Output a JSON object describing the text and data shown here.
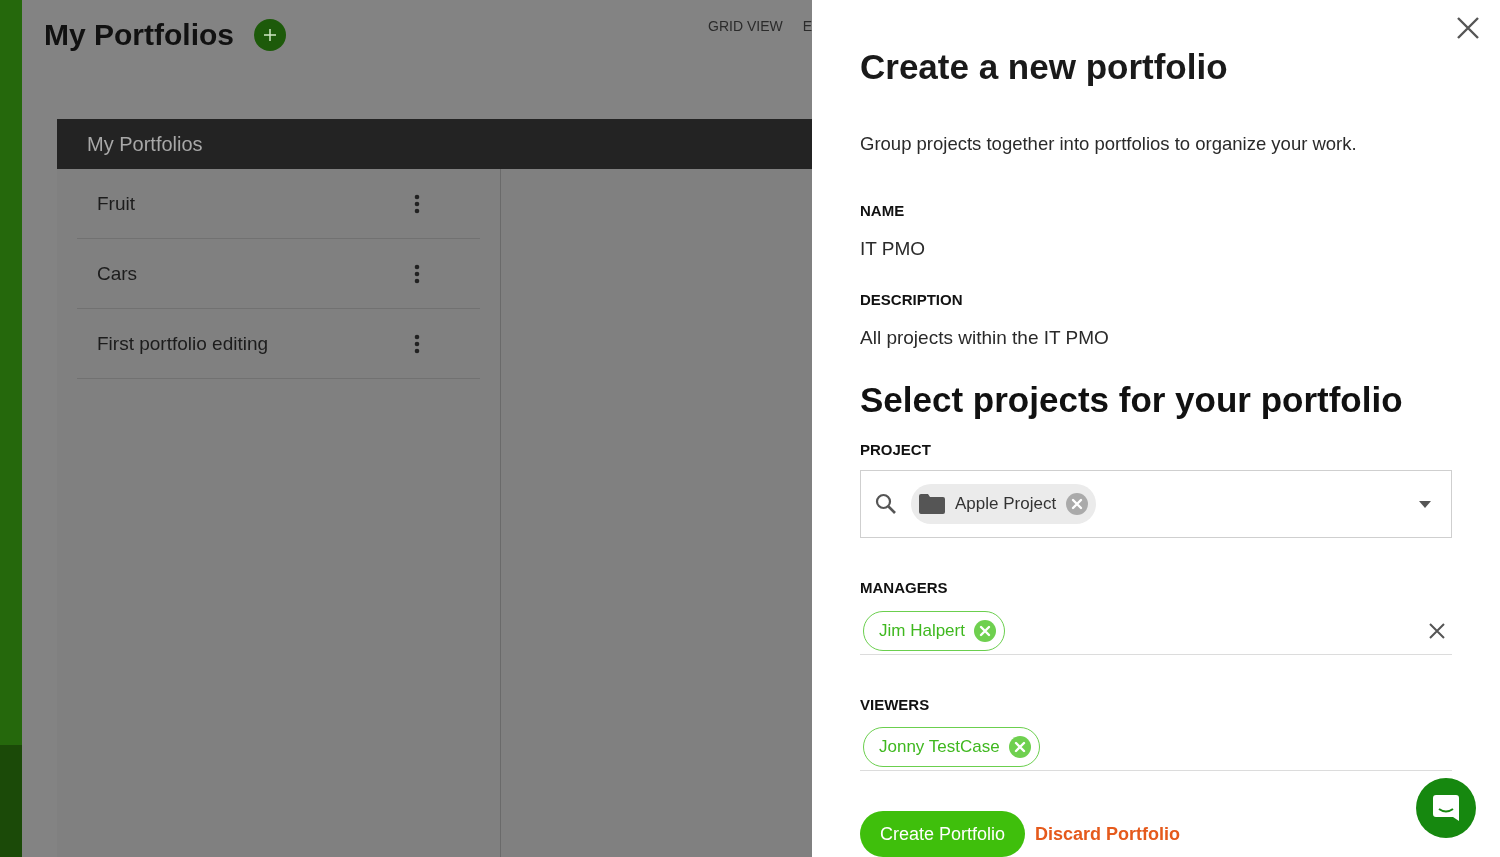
{
  "page": {
    "title": "My Portfolios",
    "view_options": [
      "GRID VIEW",
      "E"
    ]
  },
  "portfolios_card": {
    "title": "My Portfolios",
    "items": [
      {
        "name": "Fruit"
      },
      {
        "name": "Cars"
      },
      {
        "name": "First portfolio editing"
      }
    ]
  },
  "panel": {
    "title": "Create a new portfolio",
    "description": "Group projects together into portfolios to organize your work.",
    "fields": [
      {
        "label": "NAME",
        "value": "IT PMO"
      },
      {
        "label": "DESCRIPTION",
        "value": "All projects within the IT PMO"
      }
    ],
    "section_title": "Select projects for your portfolio",
    "project": {
      "label": "PROJECT",
      "chips": [
        "Apple Project"
      ]
    },
    "managers": {
      "label": "MANAGERS",
      "chips": [
        "Jim Halpert"
      ]
    },
    "viewers": {
      "label": "VIEWERS",
      "chips": [
        "Jonny TestCase"
      ]
    },
    "buttons": {
      "primary": "Create Portfolio",
      "secondary": "Discard Portfolio"
    }
  }
}
